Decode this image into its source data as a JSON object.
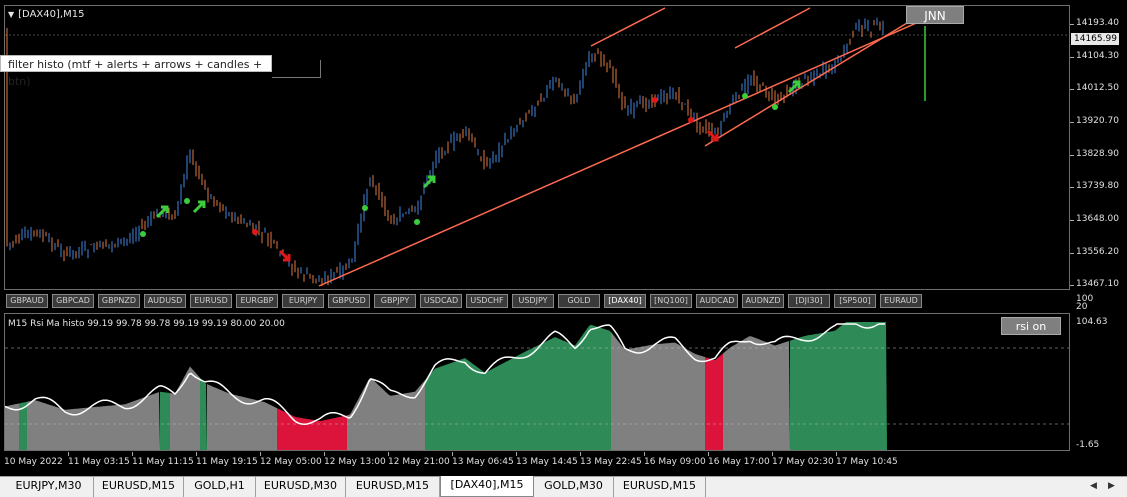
{
  "main_chart": {
    "title": "[DAX40],M15",
    "tooltip": "filter histo (mtf + alerts + arrows + candles + btn)",
    "jnn_button": "JNN",
    "current_price": "14165.99",
    "price_labels": [
      "14193.40",
      "14104.30",
      "14012.50",
      "13920.70",
      "13828.90",
      "13739.80",
      "13648.00",
      "13556.20",
      "13467.10"
    ]
  },
  "symbols": [
    "GBPAUD",
    "GBPCAD",
    "GBPNZD",
    "AUDUSD",
    "EURUSD",
    "EURGBP",
    "EURJPY",
    "GBPUSD",
    "GBPJPY",
    "USDCAD",
    "USDCHF",
    "USDJPY",
    "GOLD",
    "[DAX40]",
    "[NQ100]",
    "AUDCAD",
    "AUDNZD",
    "[DJI30]",
    "[SP500]",
    "EURAUD"
  ],
  "active_symbol": "[DAX40]",
  "indicator": {
    "title": "M15 Rsi Ma histo 99.19 99.78 99.78 99.19 99.19 80.00 20.00",
    "rsi_button": "rsi on",
    "scale_labels": [
      "100",
      "20",
      "104.63",
      "-1.65"
    ]
  },
  "time_labels": [
    "10 May 2022",
    "11 May 03:15",
    "11 May 11:15",
    "11 May 19:15",
    "12 May 05:00",
    "12 May 13:00",
    "12 May 21:00",
    "13 May 06:45",
    "13 May 14:45",
    "13 May 22:45",
    "16 May 09:00",
    "16 May 17:00",
    "17 May 02:30",
    "17 May 10:45"
  ],
  "tabs": [
    "EURJPY,M30",
    "EURUSD,M15",
    "GOLD,H1",
    "EURUSD,M30",
    "EURUSD,M15",
    "[DAX40],M15",
    "GOLD,M30",
    "EURUSD,M15"
  ],
  "active_tab": "[DAX40],M15",
  "colors": {
    "bull": "#3f86e0",
    "bear": "#e07a3f",
    "channel": "#ff6a50",
    "buy_arrow": "#3ccc3c",
    "sell_arrow": "#e01818",
    "hist_green": "#2e8b57",
    "hist_gray": "#808080",
    "hist_red": "#dc143c",
    "rsi_line": "#ffffff"
  },
  "icons": {
    "tab_prev": "triangle-left-icon",
    "tab_next": "triangle-right-icon",
    "title_menu": "triangle-down-icon"
  }
}
